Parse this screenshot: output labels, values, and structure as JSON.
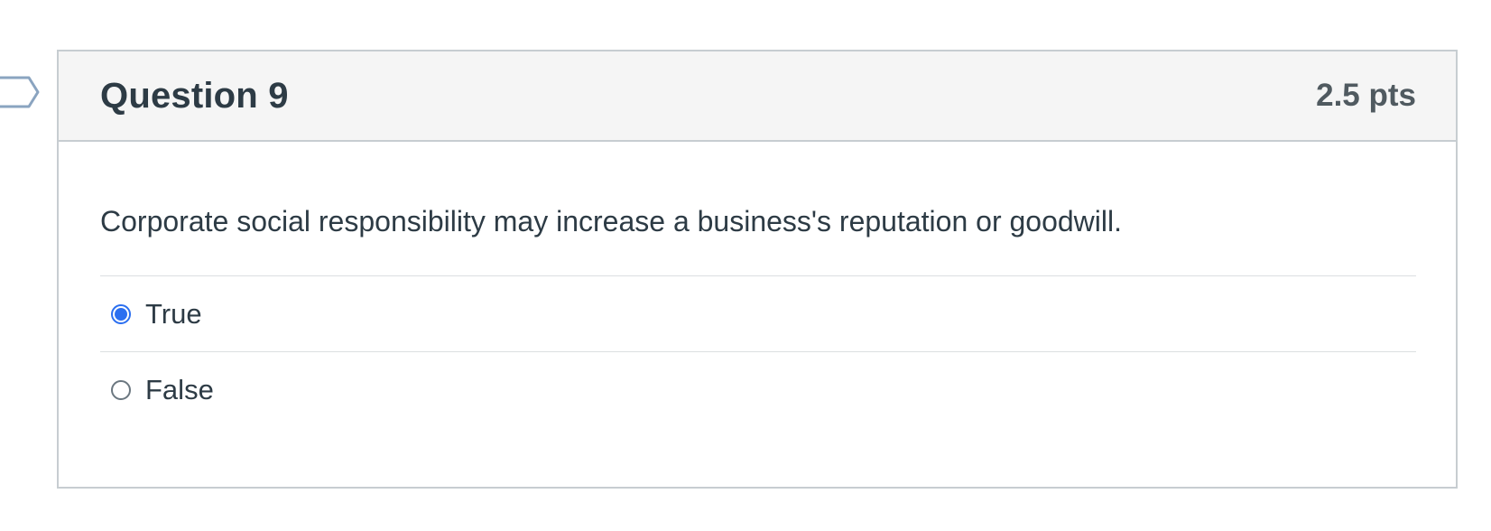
{
  "question": {
    "title": "Question 9",
    "points": "2.5 pts",
    "text": "Corporate social responsibility may increase a business's reputation or goodwill.",
    "flag_icon": "flag-icon",
    "answers": [
      {
        "label": "True",
        "selected": true
      },
      {
        "label": "False",
        "selected": false
      }
    ]
  },
  "colors": {
    "accent": "#2b6ff0",
    "border": "#c7cdd1",
    "header_bg": "#f5f5f5",
    "text": "#2d3b45",
    "flag": "#8aa4c0"
  }
}
